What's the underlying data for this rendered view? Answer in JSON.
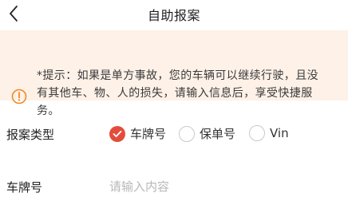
{
  "header": {
    "title": "自助报案",
    "back_icon": "chevron-left-icon"
  },
  "notice": {
    "icon": "exclamation-circle-icon",
    "icon_color": "#f08a24",
    "background": "#fdf1e8",
    "line1": "*提示：如果是单方事故，您的车辆可以继续行驶，且没",
    "line2": "有其他车、物、人的损失，请输入信息后，享受快捷服",
    "line3": "务。"
  },
  "form": {
    "case_type": {
      "label": "报案类型",
      "accent_color": "#e34c3c",
      "options": [
        {
          "label": "车牌号",
          "selected": true
        },
        {
          "label": "保单号",
          "selected": false
        },
        {
          "label": "Vin",
          "selected": false
        }
      ]
    },
    "plate": {
      "label": "车牌号",
      "value": "",
      "placeholder": "请输入内容"
    }
  }
}
